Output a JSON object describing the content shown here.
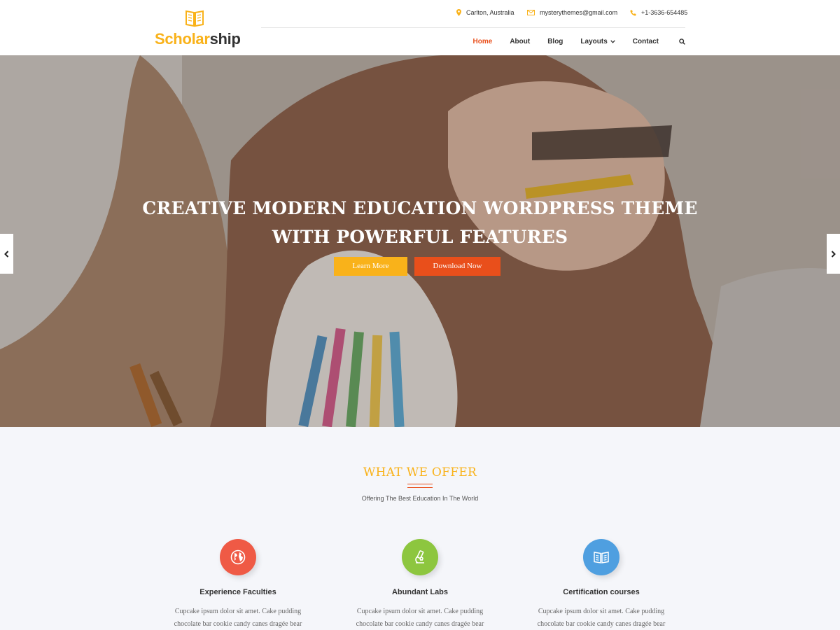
{
  "brand": {
    "name_part1": "Scholar",
    "name_part2": "ship",
    "logo_icon": "open-book-icon",
    "accent": "#f9b21a",
    "highlight": "#e94f1b"
  },
  "topbar": {
    "location": "Carlton, Australia",
    "email": "mysterythemes@gmail.com",
    "phone": "+1-3636-654485"
  },
  "nav": {
    "items": [
      "Home",
      "About",
      "Blog",
      "Layouts",
      "Contact"
    ],
    "active": "Home"
  },
  "hero": {
    "title_line1": "CREATIVE MODERN EDUCATION WORDPRESS THEME",
    "title_line2": "WITH POWERFUL FEATURES",
    "btn_learn": "Learn More",
    "btn_download": "Download Now"
  },
  "offer": {
    "title": "WHAT WE OFFER",
    "subtitle": "Offering The Best Education In The World",
    "features": [
      {
        "title": "Experience Faculties",
        "text_line1": "Cupcake ipsum dolor sit amet. Cake pudding",
        "text_line2": "chocolate bar cookie candy canes dragée bear",
        "icon": "globe-icon",
        "color": "#ef5a45"
      },
      {
        "title": "Abundant Labs",
        "text_line1": "Cupcake ipsum dolor sit amet. Cake pudding",
        "text_line2": "chocolate bar cookie candy canes dragée bear",
        "icon": "microscope-icon",
        "color": "#8dc63f"
      },
      {
        "title": "Certification courses",
        "text_line1": "Cupcake ipsum dolor sit amet. Cake pudding",
        "text_line2": "chocolate bar cookie candy canes dragée bear",
        "icon": "book-icon",
        "color": "#4f9fe0"
      }
    ]
  }
}
